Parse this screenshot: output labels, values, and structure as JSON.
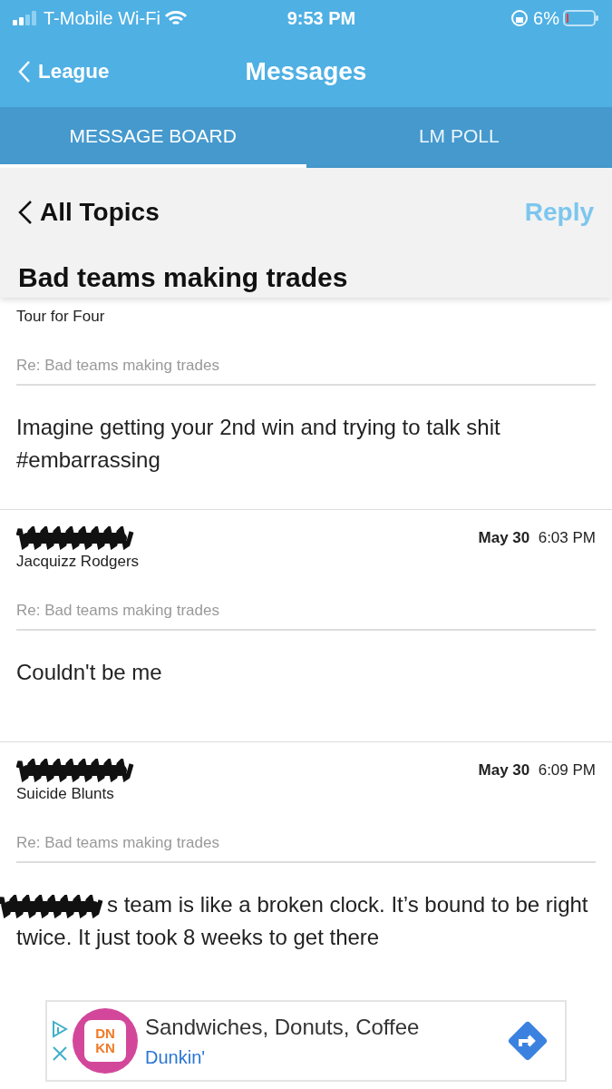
{
  "status_bar": {
    "carrier": "T-Mobile Wi-Fi",
    "time": "9:53 PM",
    "battery": "6%"
  },
  "nav": {
    "back": "League",
    "title": "Messages"
  },
  "tabs": [
    {
      "label": "MESSAGE BOARD",
      "selected": true
    },
    {
      "label": "LM POLL",
      "selected": false
    }
  ],
  "topic_bar": {
    "back": "All Topics",
    "action": "Reply",
    "title": "Bad teams making trades"
  },
  "posts": [
    {
      "team": "Tour for Four",
      "subject": "Re: Bad teams making trades",
      "body": "Imagine getting your 2nd win and trying to talk shit #embarrassing",
      "author_redacted": false,
      "body_redacted": false
    },
    {
      "team": "Jacquizz Rodgers",
      "subject": "Re: Bad teams making trades",
      "body": "Couldn't be me",
      "date": "May 30",
      "time": "6:03 PM",
      "author_redacted": true,
      "body_redacted": false
    },
    {
      "team": "Suicide Blunts",
      "subject": "Re: Bad teams making trades",
      "body": "s team is like a broken clock. It’s bound to be right twice. It just took 8 weeks to get there",
      "date": "May 30",
      "time": "6:09 PM",
      "author_redacted": true,
      "body_redacted": true
    }
  ],
  "ad": {
    "logo_lines": [
      "DN",
      "KN"
    ],
    "headline": "Sandwiches, Donuts, Coffee",
    "advertiser": "Dunkin'"
  }
}
